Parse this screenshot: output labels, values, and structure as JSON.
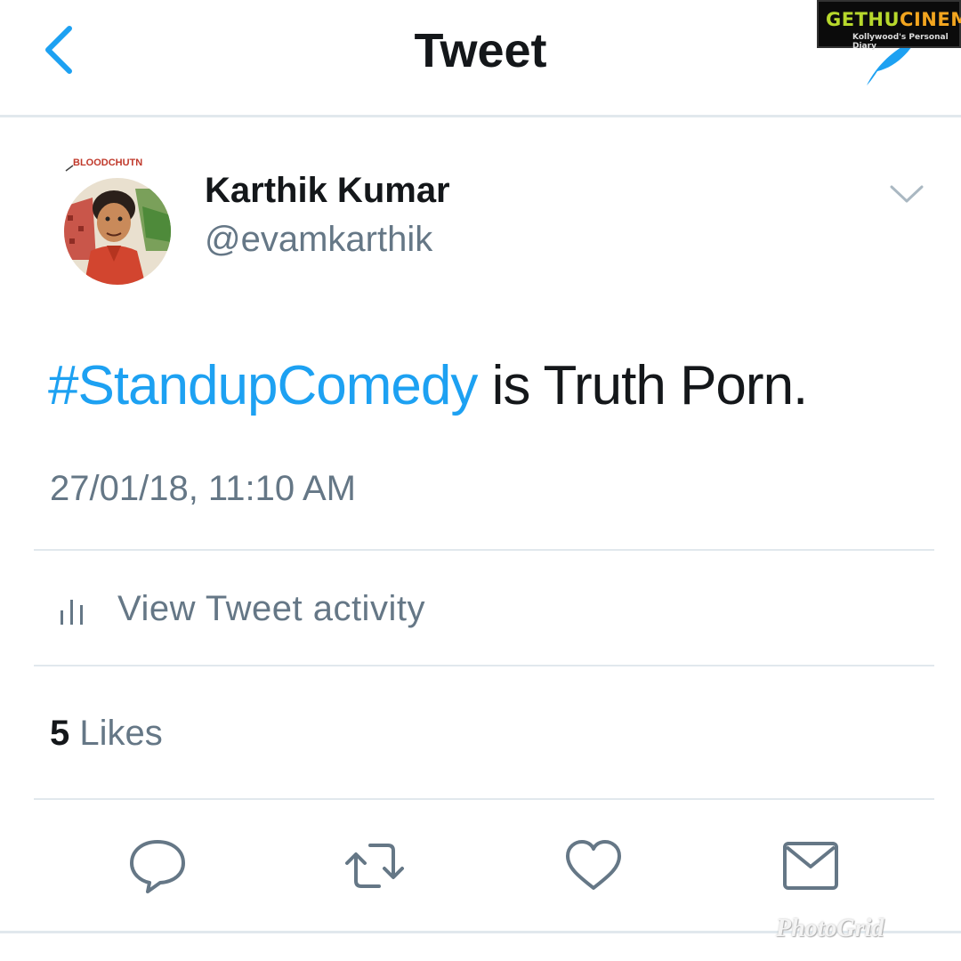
{
  "header": {
    "title": "Tweet",
    "back_icon": "chevron-left-icon",
    "compose_icon": "quill-icon"
  },
  "watermark": {
    "brand_part1": "GETHU",
    "brand_part2": "CINEMA",
    "tagline": "Kollywood's Personal Diary"
  },
  "tweet": {
    "avatar_text": "BLOODCHUTN",
    "author_name": "Karthik Kumar",
    "author_handle": "@evamkarthik",
    "hashtag": "#StandupComedy",
    "body_rest": " is Truth Porn.",
    "timestamp": "27/01/18, 11:10 AM"
  },
  "activity": {
    "label": "View Tweet activity",
    "icon": "bar-chart-icon"
  },
  "likes": {
    "count": "5",
    "label": "Likes"
  },
  "actions": [
    {
      "icon": "reply-icon"
    },
    {
      "icon": "retweet-icon"
    },
    {
      "icon": "heart-icon"
    },
    {
      "icon": "envelope-icon"
    }
  ],
  "footer_watermark": "PhotoGrid",
  "colors": {
    "accent": "#1da1f2",
    "secondary_text": "#657786",
    "primary_text": "#14171a",
    "divider": "#e1e8ed"
  }
}
